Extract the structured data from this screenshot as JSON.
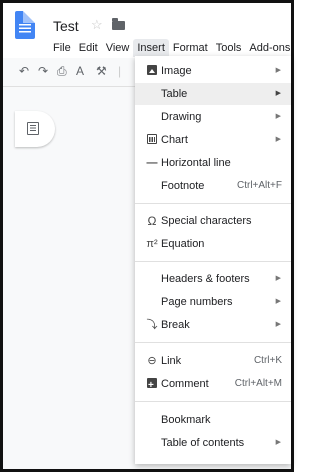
{
  "doc": {
    "title": "Test"
  },
  "icons": {
    "doc": "docs-logo-icon",
    "star": "star-icon",
    "folder": "folder-icon"
  },
  "menubar": [
    "File",
    "Edit",
    "View",
    "Insert",
    "Format",
    "Tools",
    "Add-ons"
  ],
  "insert_menu": {
    "image": "Image",
    "table": "Table",
    "drawing": "Drawing",
    "chart": "Chart",
    "horizontal_line": "Horizontal line",
    "footnote": "Footnote",
    "footnote_shortcut": "Ctrl+Alt+F",
    "special_characters": "Special characters",
    "special_characters_icon": "Ω",
    "equation": "Equation",
    "equation_icon": "π²",
    "headers_footers": "Headers & footers",
    "page_numbers": "Page numbers",
    "break": "Break",
    "link": "Link",
    "link_shortcut": "Ctrl+K",
    "comment": "Comment",
    "comment_shortcut": "Ctrl+Alt+M",
    "bookmark": "Bookmark",
    "toc": "Table of contents"
  },
  "colors": {
    "accent": "#4285f4",
    "highlight": "#eeeeee"
  }
}
